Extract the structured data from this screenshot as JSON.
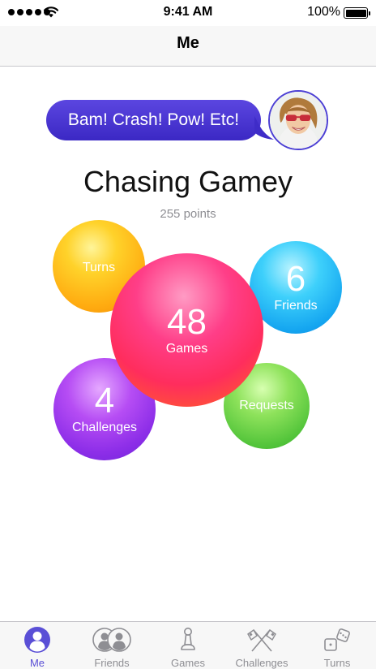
{
  "status_bar": {
    "time": "9:41 AM",
    "battery": "100%",
    "signal_icon": "cellular-signal-icon",
    "wifi_icon": "wifi-icon",
    "battery_icon": "battery-icon"
  },
  "nav": {
    "title": "Me"
  },
  "profile": {
    "status_message": "Bam! Crash! Pow! Etc!",
    "avatar": "avatar-photo",
    "name": "Chasing Gamey",
    "points": "255 points"
  },
  "bubbles": {
    "turns": {
      "label": "Turns",
      "color": "#ffc21a"
    },
    "friends": {
      "count": "6",
      "label": "Friends",
      "color": "#2cbcf7"
    },
    "games": {
      "count": "48",
      "label": "Games",
      "color": "#ff3a6e"
    },
    "challenges": {
      "count": "4",
      "label": "Challenges",
      "color": "#a63cef"
    },
    "requests": {
      "label": "Requests",
      "color": "#6fd04a"
    }
  },
  "tabs": [
    {
      "label": "Me",
      "icon": "person-icon",
      "active": true
    },
    {
      "label": "Friends",
      "icon": "friends-icon",
      "active": false
    },
    {
      "label": "Games",
      "icon": "game-piece-icon",
      "active": false
    },
    {
      "label": "Challenges",
      "icon": "crossed-flags-icon",
      "active": false
    },
    {
      "label": "Turns",
      "icon": "dice-icon",
      "active": false
    }
  ],
  "colors": {
    "accent": "#5a4fd6",
    "speech_bubble": "#4634d4",
    "tab_inactive": "#8e8e93"
  }
}
